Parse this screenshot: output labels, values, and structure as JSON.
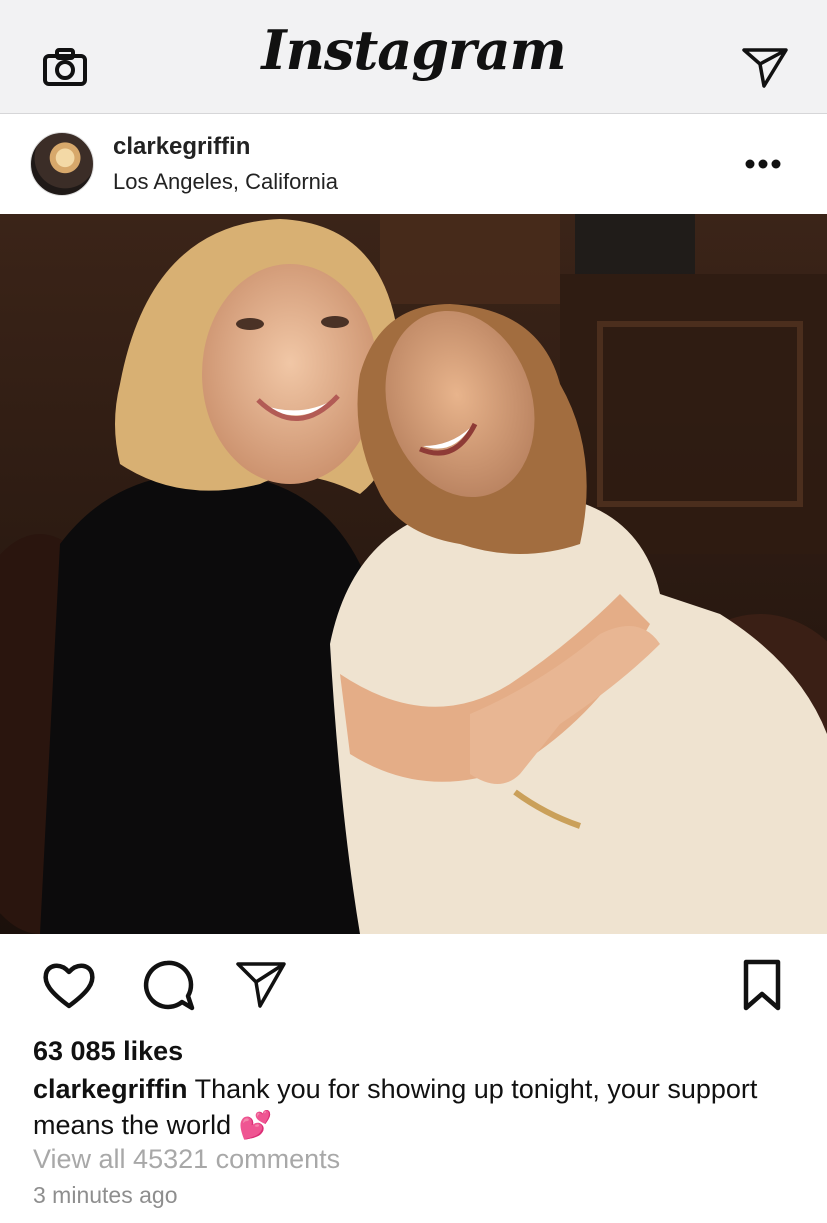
{
  "app": {
    "logo_text": "Instagram",
    "camera_icon": "camera-icon",
    "direct_icon": "paper-plane-icon"
  },
  "post": {
    "username": "clarkegriffin",
    "location": "Los Angeles, California",
    "more_icon": "ellipsis-icon",
    "photo_description": "two-women-smiling-embracing-photo"
  },
  "actions": {
    "like_icon": "heart-icon",
    "comment_icon": "speech-bubble-icon",
    "share_icon": "paper-plane-icon",
    "save_icon": "bookmark-icon"
  },
  "meta": {
    "likes": "63 085 likes",
    "caption_user": "clarkegriffin",
    "caption_text": "Thank you for showing up tonight, your support means the world 💕",
    "view_comments": "View all 45321 comments",
    "time_ago": "3 minutes ago"
  },
  "colors": {
    "topbar_bg": "#f2f2f3",
    "muted_text": "#a8a8a8"
  }
}
